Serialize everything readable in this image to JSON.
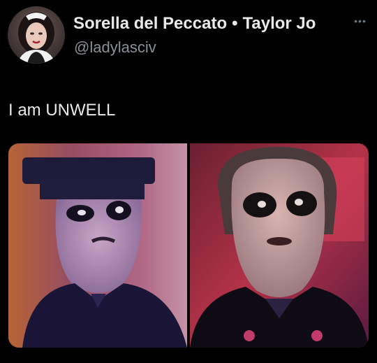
{
  "tweet": {
    "display_name": "Sorella del Peccato",
    "separator": "•",
    "display_name_extra": "Taylor Jo",
    "handle": "@ladylasciv",
    "more_icon": "ellipsis-icon",
    "text": "I am UNWELL"
  },
  "colors": {
    "background": "#000000",
    "text_primary": "#e7e9ea",
    "text_secondary": "#8b9096"
  }
}
